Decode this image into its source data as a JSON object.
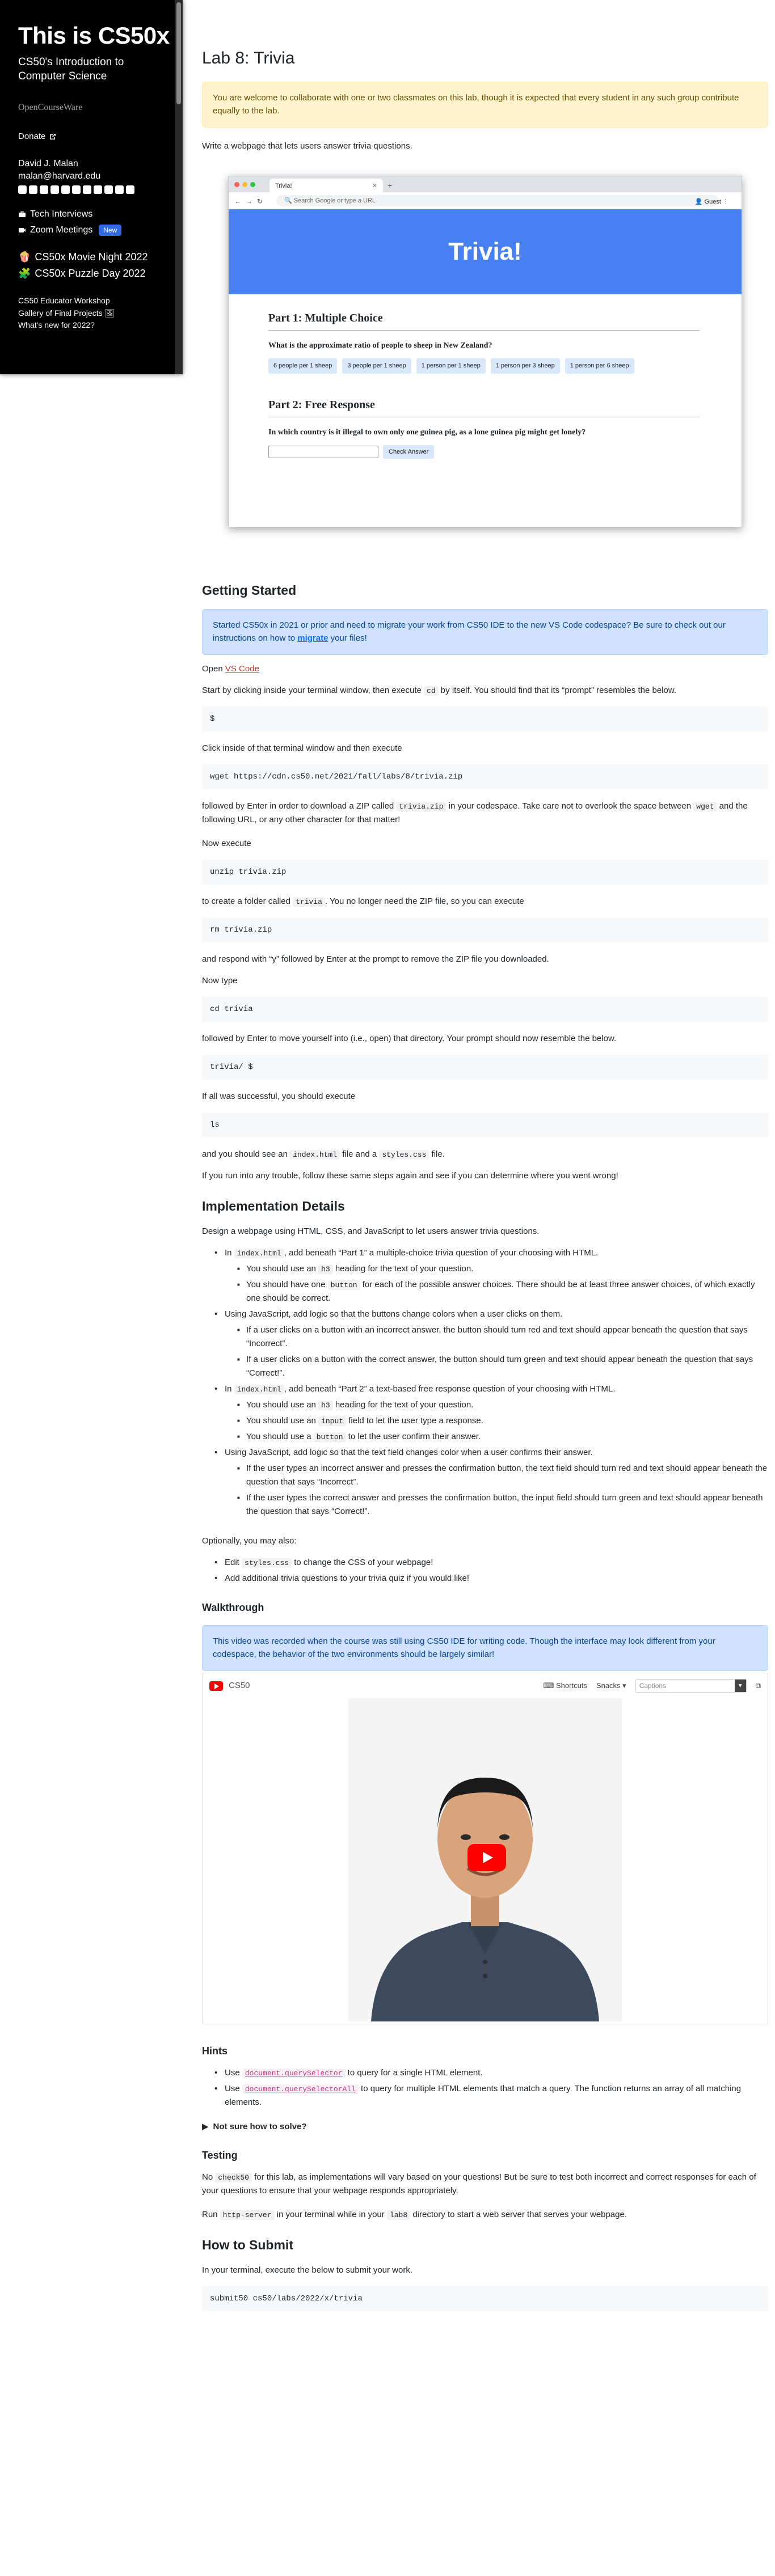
{
  "sidebar": {
    "title": "This is CS50x",
    "subtitle": "CS50's Introduction to Computer Science",
    "ocw": "OpenCourseWare",
    "donate": "Donate",
    "instructor_name": "David J. Malan",
    "instructor_email": "malan@harvard.edu",
    "links": [
      "Tech Interviews",
      "Zoom Meetings"
    ],
    "new_badge": "New",
    "events": [
      "CS50x Movie Night 2022",
      "CS50x Puzzle Day 2022"
    ],
    "extras": [
      "CS50 Educator Workshop",
      "Gallery of Final Projects",
      "What's new for 2022?"
    ]
  },
  "lab": {
    "title": "Lab 8: Trivia",
    "collab_note": "You are welcome to collaborate with one or two classmates on this lab, though it is expected that every student in any such group contribute equally to the lab.",
    "intro": "Write a webpage that lets users answer trivia questions."
  },
  "screenshot": {
    "tab_title": "Trivia!",
    "url_placeholder": "Search Google or type a URL",
    "guest": "Guest",
    "hero": "Trivia!",
    "part1_title": "Part 1: Multiple Choice",
    "part1_question": "What is the approximate ratio of people to sheep in New Zealand?",
    "choices": [
      "6 people per 1 sheep",
      "3 people per 1 sheep",
      "1 person per 1 sheep",
      "1 person per 3 sheep",
      "1 person per 6 sheep"
    ],
    "part2_title": "Part 2: Free Response",
    "part2_question": "In which country is it illegal to own only one guinea pig, as a lone guinea pig might get lonely?",
    "check_button": "Check Answer"
  },
  "getting_started": {
    "heading": "Getting Started",
    "note_a": "Started CS50x in 2021 or prior and need to migrate your work from CS50 IDE to the new VS Code codespace? Be sure to check out our instructions on how to ",
    "note_link": "migrate",
    "note_b": " your files!",
    "open": "Open ",
    "open_link": "VS Code",
    "step1_a": "Start by clicking inside your terminal window, then execute ",
    "step1_code": "cd",
    "step1_b": " by itself. You should find that its “prompt” resembles the below.",
    "prompt1": "$",
    "step2": "Click inside of that terminal window and then execute",
    "cmd_wget": "wget https://cdn.cs50.net/2021/fall/labs/8/trivia.zip",
    "step3_a": "followed by Enter in order to download a ZIP called ",
    "step3_code": "trivia.zip",
    "step3_b": " in your codespace. Take care not to overlook the space between ",
    "step3_code2": "wget",
    "step3_c": " and the following URL, or any other character for that matter!",
    "now_execute": "Now execute",
    "cmd_unzip": "unzip trivia.zip",
    "step4_a": "to create a folder called ",
    "step4_code": "trivia",
    "step4_b": ". You no longer need the ZIP file, so you can execute",
    "cmd_rm": "rm trivia.zip",
    "step5": "and respond with “y” followed by Enter at the prompt to remove the ZIP file you downloaded.",
    "now_type": "Now type",
    "cmd_cd": "cd trivia",
    "step6": "followed by Enter to move yourself into (i.e., open) that directory. Your prompt should now resemble the below.",
    "prompt2": "trivia/ $",
    "step7": "If all was successful, you should execute",
    "cmd_ls": "ls",
    "step8_a": "and you should see an ",
    "step8_code1": "index.html",
    "step8_b": " file and a ",
    "step8_code2": "styles.css",
    "step8_c": " file.",
    "step9": "If you run into any trouble, follow these same steps again and see if you can determine where you went wrong!"
  },
  "impl": {
    "heading": "Implementation Details",
    "intro": "Design a webpage using HTML, CSS, and JavaScript to let users answer trivia questions.",
    "b1_a": "In ",
    "b1_code": "index.html",
    "b1_b": ", add beneath “Part 1” a multiple-choice trivia question of your choosing with HTML.",
    "b1_s1_a": "You should use an ",
    "b1_s1_code": "h3",
    "b1_s1_b": " heading for the text of your question.",
    "b1_s2_a": "You should have one ",
    "b1_s2_code": "button",
    "b1_s2_b": " for each of the possible answer choices. There should be at least three answer choices, of which exactly one should be correct.",
    "b2": "Using JavaScript, add logic so that the buttons change colors when a user clicks on them.",
    "b2_s1": "If a user clicks on a button with an incorrect answer, the button should turn red and text should appear beneath the question that says “Incorrect”.",
    "b2_s2": "If a user clicks on a button with the correct answer, the button should turn green and text should appear beneath the question that says “Correct!”.",
    "b3_a": "In ",
    "b3_code": "index.html",
    "b3_b": ", add beneath “Part 2” a text-based free response question of your choosing with HTML.",
    "b3_s1_a": "You should use an ",
    "b3_s1_code": "h3",
    "b3_s1_b": " heading for the text of your question.",
    "b3_s2_a": "You should use an ",
    "b3_s2_code": "input",
    "b3_s2_b": " field to let the user type a response.",
    "b3_s3_a": "You should use a ",
    "b3_s3_code": "button",
    "b3_s3_b": " to let the user confirm their answer.",
    "b4": "Using JavaScript, add logic so that the text field changes color when a user confirms their answer.",
    "b4_s1": "If the user types an incorrect answer and presses the confirmation button, the text field should turn red and text should appear beneath the question that says “Incorrect”.",
    "b4_s2": "If the user types the correct answer and presses the confirmation button, the input field should turn green and text should appear beneath the question that says “Correct!”.",
    "optional": "Optionally, you may also:",
    "o1_a": "Edit ",
    "o1_code": "styles.css",
    "o1_b": " to change the CSS of your webpage!",
    "o2": "Add additional trivia questions to your trivia quiz if you would like!"
  },
  "walkthrough": {
    "heading": "Walkthrough",
    "note": "This video was recorded when the course was still using CS50 IDE for writing code. Though the interface may look different from your codespace, the behavior of the two environments should be largely similar!",
    "channel": "CS50",
    "shortcuts": "Shortcuts",
    "snacks": "Snacks",
    "captions": "Captions"
  },
  "hints": {
    "heading": "Hints",
    "h1_a": "Use ",
    "h1_code": "document.querySelector",
    "h1_b": " to query for a single HTML element.",
    "h2_a": "Use ",
    "h2_code": "document.querySelectorAll",
    "h2_b": " to query for multiple HTML elements that match a query. The function returns an array of all matching elements.",
    "details": "Not sure how to solve?"
  },
  "testing": {
    "heading": "Testing",
    "t1_a": "No ",
    "t1_code": "check50",
    "t1_b": " for this lab, as implementations will vary based on your questions! But be sure to test both incorrect and correct responses for each of your questions to ensure that your webpage responds appropriately.",
    "t2_a": "Run ",
    "t2_code": "http-server",
    "t2_b": " in your terminal while in your ",
    "t2_code2": "lab8",
    "t2_c": " directory to start a web server that serves your webpage."
  },
  "submit": {
    "heading": "How to Submit",
    "intro": "In your terminal, execute the below to submit your work.",
    "cmd": "submit50 cs50/labs/2022/x/trivia"
  }
}
